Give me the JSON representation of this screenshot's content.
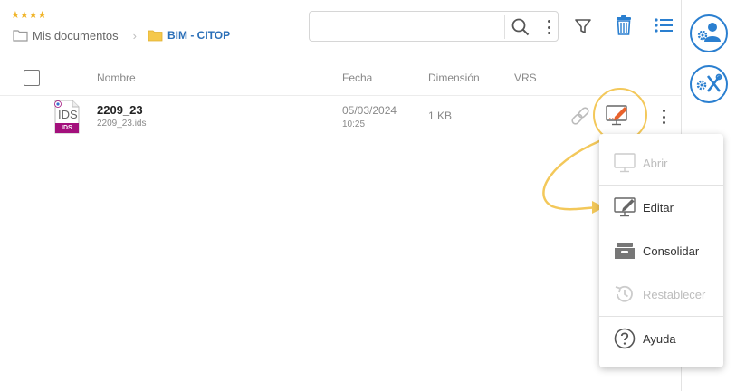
{
  "rating": {
    "stars": "★★★★"
  },
  "breadcrumb": [
    {
      "label": "Mis documentos"
    },
    {
      "label": "BIM - CITOP"
    }
  ],
  "search": {
    "value": "",
    "placeholder": ""
  },
  "toolbar": {
    "search_icon": "search-icon",
    "more_icon": "more-vertical-icon",
    "filter_icon": "filter-icon",
    "trash_icon": "trash-icon",
    "list_icon": "list-view-icon"
  },
  "table": {
    "columns": [
      "Nombre",
      "Fecha",
      "Dimensión",
      "VRS"
    ],
    "rows": [
      {
        "name": "2209_23",
        "filename": "2209_23.ids",
        "date": "05/03/2024",
        "time": "10:25",
        "size": "1 KB",
        "type_label": "IDS",
        "type_badge": "IDS",
        "vrs": ""
      }
    ]
  },
  "context_menu": {
    "items": [
      {
        "label": "Abrir",
        "icon": "monitor-icon",
        "disabled": true
      },
      {
        "label": "Editar",
        "icon": "monitor-edit-icon",
        "disabled": false
      },
      {
        "label": "Consolidar",
        "icon": "archive-drawer-icon",
        "disabled": false
      },
      {
        "label": "Restablecer",
        "icon": "history-icon",
        "disabled": true
      },
      {
        "label": "Ayuda",
        "icon": "help-icon",
        "disabled": false
      }
    ]
  },
  "colors": {
    "accent": "#2a7fd0",
    "folder": "#f5c84c",
    "highlight": "#f3c85a",
    "edit_orange": "#e8622c",
    "ids_badge": "#a3107c"
  }
}
